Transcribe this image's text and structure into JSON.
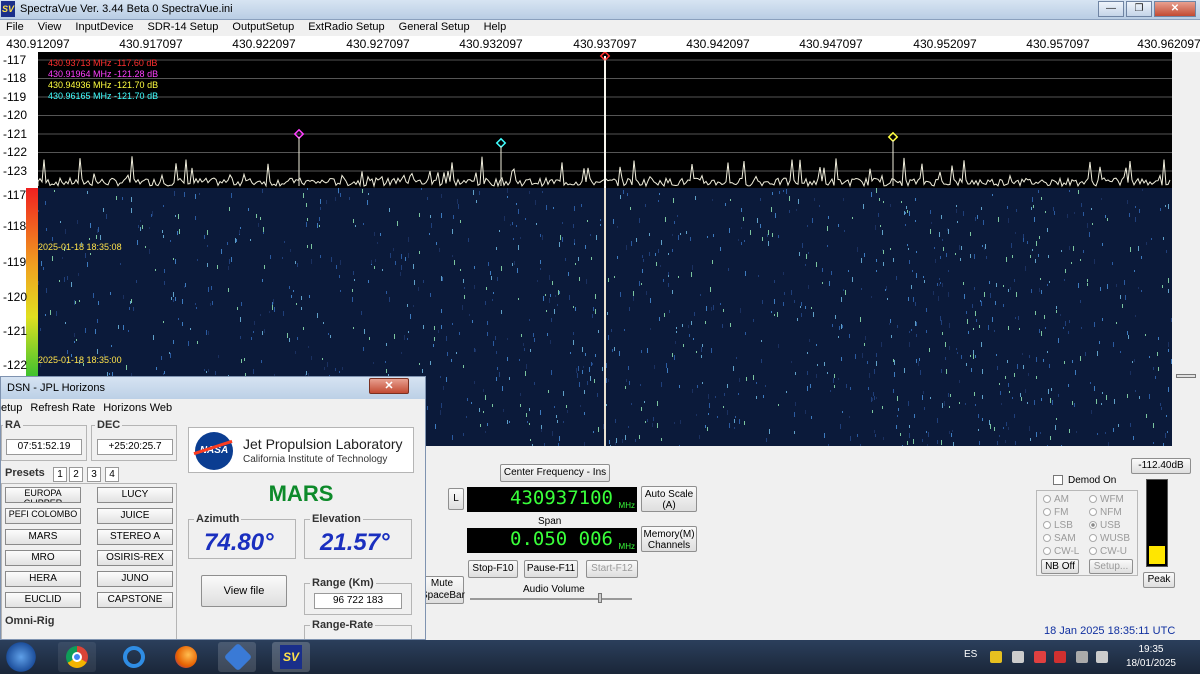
{
  "app": {
    "title": "SpectraVue Ver. 3.44 Beta 0   SpectraVue.ini",
    "logo": "SV",
    "window_buttons": {
      "minimize": "—",
      "maximize": "❐",
      "close": "✕"
    }
  },
  "menu": [
    "File",
    "View",
    "InputDevice",
    "SDR-14 Setup",
    "OutputSetup",
    "ExtRadio Setup",
    "General Setup",
    "Help"
  ],
  "freq_axis": [
    "430.912097",
    "430.917097",
    "430.922097",
    "430.927097",
    "430.932097",
    "430.937097",
    "430.942097",
    "430.947097",
    "430.952097",
    "430.957097",
    "430.962097"
  ],
  "db_axis": [
    "-117",
    "-118",
    "-119",
    "-120",
    "-121",
    "-122",
    "-123"
  ],
  "markers": [
    {
      "text": "430.93713 MHz -117.60 dB",
      "color": "#ff3030"
    },
    {
      "text": "430.91964 MHz -121.28 dB",
      "color": "#ff40ff"
    },
    {
      "text": "430.94936 MHz -121.70 dB",
      "color": "#ffff40"
    },
    {
      "text": "430.96165 MHz -121.70 dB",
      "color": "#40ffff"
    }
  ],
  "waterfall": {
    "scale": [
      "-117",
      "-118",
      "-119",
      "-120",
      "-121",
      "-122"
    ],
    "timestamps": [
      "2025-01-18 18:35:08",
      "2025-01-18 18:35:00"
    ]
  },
  "controls": {
    "center_freq_button": "Center Frequency - Ins",
    "l_button": "L",
    "center_freq_value": "430937100",
    "freq_unit": "MHz",
    "auto_scale_button": "Auto Scale\n(A)",
    "span_label": "Span",
    "span_value": "0.050 006",
    "memory_button": "Memory(M)\nChannels",
    "stop_button": "Stop-F10",
    "pause_button": "Pause-F11",
    "start_button": "Start-F12",
    "mute_button": "Mute\nSpaceBar",
    "audio_volume_label": "Audio Volume",
    "level_readout": "-112.40dB",
    "demod_label": "Demod On",
    "modes": [
      "AM",
      "WFM",
      "FM",
      "NFM",
      "LSB",
      "USB",
      "SAM",
      "WUSB",
      "CW-L",
      "CW-U"
    ],
    "selected_mode": "USB",
    "nb_button": "NB Off",
    "setup_button": "Setup...",
    "peak_button": "Peak",
    "utc_time": "18 Jan 2025   18:35:11 UTC",
    "meter_level": 0.22
  },
  "dsn": {
    "title": "DSN - JPL Horizons",
    "close": "✕",
    "menu": [
      "etup",
      "Refresh Rate",
      "Horizons Web"
    ],
    "ra_label": "RA",
    "ra_value": "07:51:52.19",
    "dec_label": "DEC",
    "dec_value": "+25:20:25.7",
    "presets_label": "Presets",
    "preset_tabs": [
      "1",
      "2",
      "3",
      "4"
    ],
    "presets_left": [
      "EUROPA CLIPPER",
      "PEFI COLOMBO",
      "MARS",
      "MRO",
      "HERA",
      "EUCLID"
    ],
    "presets_right": [
      "LUCY",
      "JUICE",
      "STEREO A",
      "OSIRIS-REX",
      "JUNO",
      "CAPSTONE"
    ],
    "jpl_title": "Jet Propulsion Laboratory",
    "jpl_subtitle": "California Institute of Technology",
    "nasa_logo": "NASA",
    "target": "MARS",
    "azimuth_label": "Azimuth",
    "azimuth_value": "74.80°",
    "elevation_label": "Elevation",
    "elevation_value": "21.57°",
    "view_file_button": "View file",
    "range_label": "Range (Km)",
    "range_value": "96 722 183",
    "range_rate_label": "Range-Rate",
    "omnirig_label": "Omni-Rig"
  },
  "taskbar": {
    "lang": "ES",
    "time": "19:35",
    "date": "18/01/2025"
  }
}
